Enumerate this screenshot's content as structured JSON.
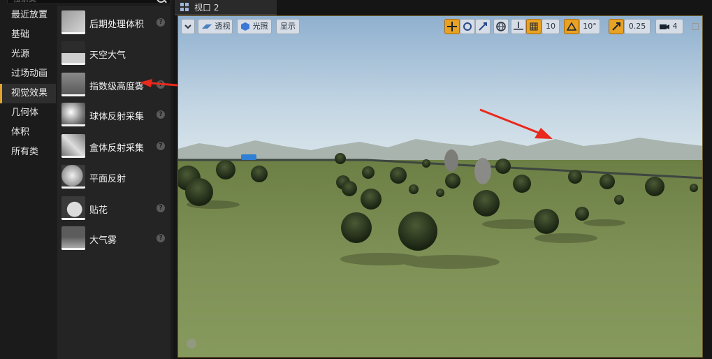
{
  "search": {
    "placeholder": "搜索类"
  },
  "categories": [
    "最近放置",
    "基础",
    "光源",
    "过场动画",
    "视觉效果",
    "几何体",
    "体积",
    "所有类"
  ],
  "active_category_index": 4,
  "items": [
    {
      "label": "后期处理体积",
      "help": true
    },
    {
      "label": "天空大气",
      "help": false
    },
    {
      "label": "指数级高度雾",
      "help": true
    },
    {
      "label": "球体反射采集",
      "help": true
    },
    {
      "label": "盒体反射采集",
      "help": true
    },
    {
      "label": "平面反射",
      "help": false
    },
    {
      "label": "贴花",
      "help": true
    },
    {
      "label": "大气雾",
      "help": true
    }
  ],
  "viewport": {
    "tab_label": "视口 2",
    "toolbar": {
      "perspective_label": "透视",
      "lit_label": "光照",
      "show_label": "显示",
      "grid_snap_value": "10",
      "rotation_snap_value": "10°",
      "scale_snap_value": "0.25",
      "camera_speed_value": "4"
    }
  },
  "colors": {
    "accent": "#e3a32a",
    "toolbar_active": "#e8a224",
    "annotation_arrow": "#e8291c"
  }
}
